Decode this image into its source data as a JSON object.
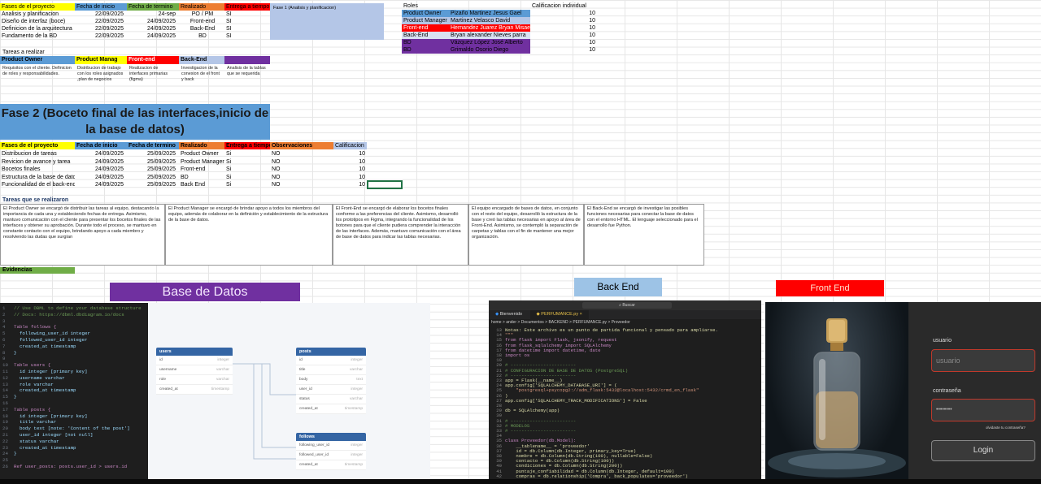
{
  "phase1": {
    "headers": [
      "Fases de el proyecto",
      "Fecha de inicio",
      "Fecha de termino",
      "Realizado",
      "Entrega a tiempo"
    ],
    "rows": [
      [
        "Analisis y planificacion",
        "22/09/2025",
        "24-sep",
        "PO / PM",
        "SI"
      ],
      [
        "Diseño de interfaz (boce)",
        "22/09/2025",
        "24/09/2025",
        "Front-end",
        "SI"
      ],
      [
        "Definicion de la arquitectura",
        "22/09/2025",
        "24/09/2025",
        "Back-End",
        "SI"
      ],
      [
        "Fundamento de la BD",
        "22/09/2025",
        "24/09/2025",
        "BD",
        "SI"
      ]
    ],
    "phase_label": "Fase 1 (Analisis y planificacion)",
    "tasks_label": "Tareas a realizar",
    "roles": [
      "Product Owner",
      "Product Manag",
      "Front-end",
      "Back-End",
      ""
    ],
    "role_notes": [
      "Requisitos con el cliente. Definicion de roles y responsabilidades.",
      "Distribucion de trabajo con los roles asignados ,plan de negocios",
      "Realizacion de interfaces primarias (figma)",
      "Investigacion de la conexion de el front y back",
      "Analisis de la tablas que se requerida"
    ]
  },
  "roles_table": {
    "headers": [
      "Roles",
      "",
      "Calificacion individual"
    ],
    "rows": [
      [
        "Product Owner",
        "Pizaño Martinez Jesus Gael",
        "10"
      ],
      [
        "Product Manager",
        "Martinez Velasco David",
        "10"
      ],
      [
        "Front-end",
        "Hernandez Juarez Bryan Misael",
        "10"
      ],
      [
        "Back-End",
        "Bryan alexander Nieves parra",
        "10"
      ],
      [
        "BD",
        "Vázquez López José Alberto",
        "10"
      ],
      [
        "BD",
        "Grimaldo Osorio Diego",
        "10"
      ]
    ]
  },
  "phase2": {
    "title_line1": "Fase 2 (Boceto final de las interfaces,inicio de",
    "title_line2": "la base de datos)",
    "headers": [
      "Fases de el proyecto",
      "Fecha de inicio",
      "Fecha de termino",
      "Realizado",
      "Entrega a tiempo",
      "Observaciones",
      "Calificacion"
    ],
    "rows": [
      [
        "Distribucion de tareas",
        "24/09/2025",
        "25/09/2025",
        "Product Owner",
        "Si",
        "NO",
        "10"
      ],
      [
        "Revicion de avance y tarea",
        "24/09/2025",
        "25/09/2025",
        "Product Manager",
        "Si",
        "NO",
        "10"
      ],
      [
        "Bocetos finales",
        "24/09/2025",
        "25/09/2025",
        "Front-end",
        "Si",
        "NO",
        "10"
      ],
      [
        "Estructura de la base de datos",
        "24/09/2025",
        "25/09/2025",
        "BD",
        "Si",
        "NO",
        "10"
      ],
      [
        "Funcionalidad de el back-end",
        "24/09/2025",
        "25/09/2025",
        "Back End",
        "Si",
        "NO",
        "10"
      ]
    ],
    "tasks_label": "Tareas que se realizaron",
    "notes": [
      "El Product Owner se encargó de distribuir las tareas al equipo, destacando la importancia de cada una y estableciendo fechas de entrega. Asimismo, mantuvo comunicación con el cliente para presentar los bocetos finales de las interfaces y obtener su aprobación. Durante todo el proceso, se mantuvo en constante contacto con el equipo, brindando apoyo a cada miembro y resolviendo las dudas que surgían",
      "El Product Manager se encargó de brindar apoyo a todos los miembros del equipo, además de colaborar en la definición y establecimiento de la estructura de la base de datos.",
      "El Front-End se encargó de elaborar los bocetos finales conforme a las preferencias del cliente. Asimismo, desarrolló los prototipos en Figma, integrando la funcionalidad de los botones para que el cliente pudiera comprender la interacción de las interfaces. Además, mantuvo comunicación con el área de base de datos para indicar las tablas necesarias.",
      "El equipo encargado de bases de datos, en conjunto con el resto del equipo, desarrolló la estructura de la base y creó las tablas necesarias en apoyo al área de Front-End. Asimismo, se contempló la separación de carpetas y tablas con el fin de mantener una mejor organización.",
      "El Back-End se encargó de investigar las posibles funciones necesarias para conectar la base de datos con el entorno HTML. El lenguaje seleccionado para el desarrollo fue Python."
    ]
  },
  "evidence": {
    "label": "Evidencias",
    "bd_title": "Base de Datos",
    "be_title": "Back End",
    "fe_title": "Front End"
  },
  "dbcode": [
    "// Use DBML to define your database structure",
    "// Docs: https://dbml.dbdiagram.io/docs",
    "",
    "Table follows {",
    "  following_user_id integer",
    "  followed_user_id integer",
    "  created_at timestamp",
    "}",
    "",
    "Table users {",
    "  id integer [primary key]",
    "  username varchar",
    "  role varchar",
    "  created_at timestamp",
    "}",
    "",
    "Table posts {",
    "  id integer [primary key]",
    "  title varchar",
    "  body text [note: 'Content of the post']",
    "  user_id integer [not null]",
    "  status varchar",
    "  created_at timestamp",
    "}",
    "",
    "Ref user_posts: posts.user_id > users.id"
  ],
  "diagram": {
    "users": {
      "title": "users",
      "fields": [
        [
          "id",
          "integer"
        ],
        [
          "username",
          "varchar"
        ],
        [
          "role",
          "varchar"
        ],
        [
          "created_at",
          "timestamp"
        ]
      ]
    },
    "posts": {
      "title": "posts",
      "fields": [
        [
          "id",
          "integer"
        ],
        [
          "title",
          "varchar"
        ],
        [
          "body",
          "text"
        ],
        [
          "user_id",
          "integer"
        ],
        [
          "status",
          "varchar"
        ],
        [
          "created_at",
          "timestamp"
        ]
      ]
    },
    "follows": {
      "title": "follows",
      "fields": [
        [
          "following_user_id",
          "integer"
        ],
        [
          "followed_user_id",
          "integer"
        ],
        [
          "created_at",
          "timestamp"
        ]
      ]
    }
  },
  "vscode": {
    "search": "Buscar",
    "tab1": "Bienvenido",
    "tab2": "PERFUMANCE.py",
    "breadcrumb": "home > ander > Documentos > BACKEND > PERFUMANCE.py > Proveedor",
    "lines": [
      [
        "13",
        "Notas: Este archivo es un punto de partida funcional y pensado para ampliarse."
      ],
      [
        "14",
        "\"\"\""
      ],
      [
        "15",
        "from flask import Flask, jsonify, request"
      ],
      [
        "16",
        "from flask_sqlalchemy import SQLAlchemy"
      ],
      [
        "17",
        "from datetime import datetime, date"
      ],
      [
        "18",
        "import os"
      ],
      [
        "19",
        ""
      ],
      [
        "20",
        "# ------------------------"
      ],
      [
        "21",
        "# CONFIGURACION DE BASE DE DATOS (PostgreSQL)"
      ],
      [
        "22",
        "# ------------------------"
      ],
      [
        "23",
        "app = Flask(__name__)"
      ],
      [
        "24",
        "app.config['SQLALCHEMY_DATABASE_URI'] = ("
      ],
      [
        "25",
        "    \"postgresql+psycopg2://adm_flask:5432@localhost:5432/crmd_en_flask\""
      ],
      [
        "26",
        ")"
      ],
      [
        "27",
        "app.config['SQLALCHEMY_TRACK_MODIFICATIONS'] = False"
      ],
      [
        "28",
        ""
      ],
      [
        "29",
        "db = SQLAlchemy(app)"
      ],
      [
        "30",
        ""
      ],
      [
        "31",
        "# ------------------------"
      ],
      [
        "32",
        "# MODELOS"
      ],
      [
        "33",
        "# ------------------------"
      ],
      [
        "34",
        ""
      ],
      [
        "35",
        "class Proveedor(db.Model):"
      ],
      [
        "36",
        "    __tablename__ = 'proveedor'"
      ],
      [
        "37",
        "    id = db.Column(db.Integer, primary_key=True)"
      ],
      [
        "38",
        "    nombre = db.Column(db.String(100), nullable=False)"
      ],
      [
        "39",
        "    contacto = db.Column(db.String(100))"
      ],
      [
        "40",
        "    condiciones = db.Column(db.String(200))"
      ],
      [
        "41",
        "    puntaje_confiabilidad = db.Column(db.Integer, default=100)"
      ],
      [
        "42",
        "    compras = db.relationship('Compra', back_populates='proveedor')"
      ]
    ]
  },
  "login": {
    "user_label": "usuario",
    "user_placeholder": "usuario",
    "pass_label": "contraseña",
    "pass_value": "••••••••",
    "forgot": "olvidaste tu contraseña?",
    "button": "Login"
  },
  "colors": {
    "yellow": "#ffff00",
    "blue": "#5b9bd5",
    "green": "#70ad47",
    "orange": "#ed7d31",
    "red": "#ff0000",
    "purple": "#7030a0",
    "lightblue": "#b4c6e7",
    "lightpurple": "#8e7cc3"
  }
}
